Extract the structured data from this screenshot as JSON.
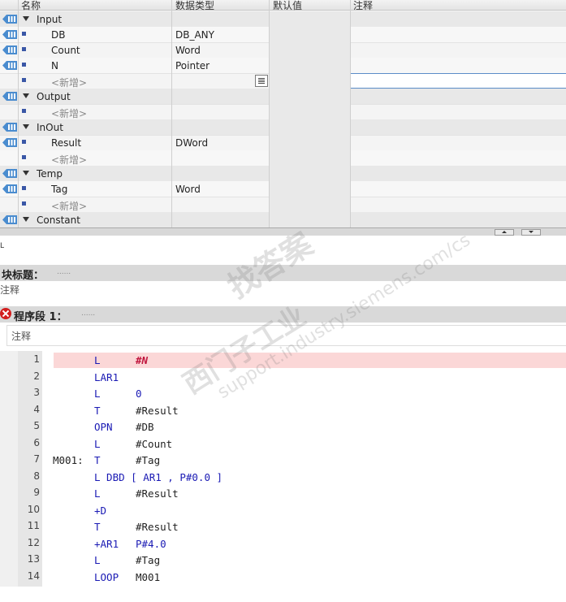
{
  "table": {
    "headers": [
      "名称",
      "数据类型",
      "默认值",
      "注释"
    ],
    "rows": [
      {
        "kind": "section",
        "name": "Input",
        "type": ""
      },
      {
        "kind": "item",
        "name": "DB",
        "type": "DB_ANY"
      },
      {
        "kind": "item",
        "name": "Count",
        "type": "Word"
      },
      {
        "kind": "item",
        "name": "N",
        "type": "Pointer"
      },
      {
        "kind": "new",
        "name": "<新增>",
        "type": ""
      },
      {
        "kind": "section",
        "name": "Output",
        "type": ""
      },
      {
        "kind": "new",
        "name": "<新增>",
        "type": ""
      },
      {
        "kind": "section",
        "name": "InOut",
        "type": ""
      },
      {
        "kind": "item",
        "name": "Result",
        "type": "DWord"
      },
      {
        "kind": "new",
        "name": "<新增>",
        "type": ""
      },
      {
        "kind": "section",
        "name": "Temp",
        "type": ""
      },
      {
        "kind": "item",
        "name": "Tag",
        "type": "Word"
      },
      {
        "kind": "new",
        "name": "<新增>",
        "type": ""
      },
      {
        "kind": "section",
        "name": "Constant",
        "type": ""
      }
    ]
  },
  "editor": {
    "tiny_label": "L",
    "block_title": "块标题：",
    "block_title_dots": "......",
    "block_comment": "注释",
    "network_title": "程序段 1：",
    "network_title_dots": "......",
    "network_comment": "注释"
  },
  "code": [
    {
      "num": "1",
      "label": "",
      "op": "L",
      "arg": "#N",
      "arg_style": "err",
      "full": "",
      "highlight": true
    },
    {
      "num": "2",
      "label": "",
      "op": "LAR1",
      "arg": "",
      "arg_style": "",
      "full": "",
      "highlight": false
    },
    {
      "num": "3",
      "label": "",
      "op": "L",
      "arg": "0",
      "arg_style": "blue",
      "full": "",
      "highlight": false
    },
    {
      "num": "4",
      "label": "",
      "op": "T",
      "arg": "#Result",
      "arg_style": "",
      "full": "",
      "highlight": false
    },
    {
      "num": "5",
      "label": "",
      "op": "OPN",
      "arg": "#DB",
      "arg_style": "",
      "full": "",
      "highlight": false
    },
    {
      "num": "6",
      "label": "",
      "op": "L",
      "arg": "#Count",
      "arg_style": "",
      "full": "",
      "highlight": false
    },
    {
      "num": "7",
      "label": "M001:",
      "op": "T",
      "arg": "#Tag",
      "arg_style": "",
      "full": "",
      "highlight": false
    },
    {
      "num": "8",
      "label": "",
      "op": "",
      "arg": "",
      "arg_style": "",
      "full": "L DBD [ AR1 , P#0.0 ]",
      "highlight": false
    },
    {
      "num": "9",
      "label": "",
      "op": "L",
      "arg": "#Result",
      "arg_style": "",
      "full": "",
      "highlight": false
    },
    {
      "num": "10",
      "label": "",
      "op": "+D",
      "arg": "",
      "arg_style": "",
      "full": "",
      "highlight": false
    },
    {
      "num": "11",
      "label": "",
      "op": "T",
      "arg": "#Result",
      "arg_style": "",
      "full": "",
      "highlight": false
    },
    {
      "num": "12",
      "label": "",
      "op": "+AR1",
      "arg": "P#4.0",
      "arg_style": "blue",
      "full": "",
      "highlight": false
    },
    {
      "num": "13",
      "label": "",
      "op": "L",
      "arg": "#Tag",
      "arg_style": "",
      "full": "",
      "highlight": false
    },
    {
      "num": "14",
      "label": "",
      "op": "LOOP",
      "arg": "M001",
      "arg_style": "",
      "full": "",
      "highlight": false
    }
  ],
  "watermark": {
    "line1": "找答案",
    "line2": "西门子工业",
    "line3": "support.industry.siemens.com/cs"
  }
}
